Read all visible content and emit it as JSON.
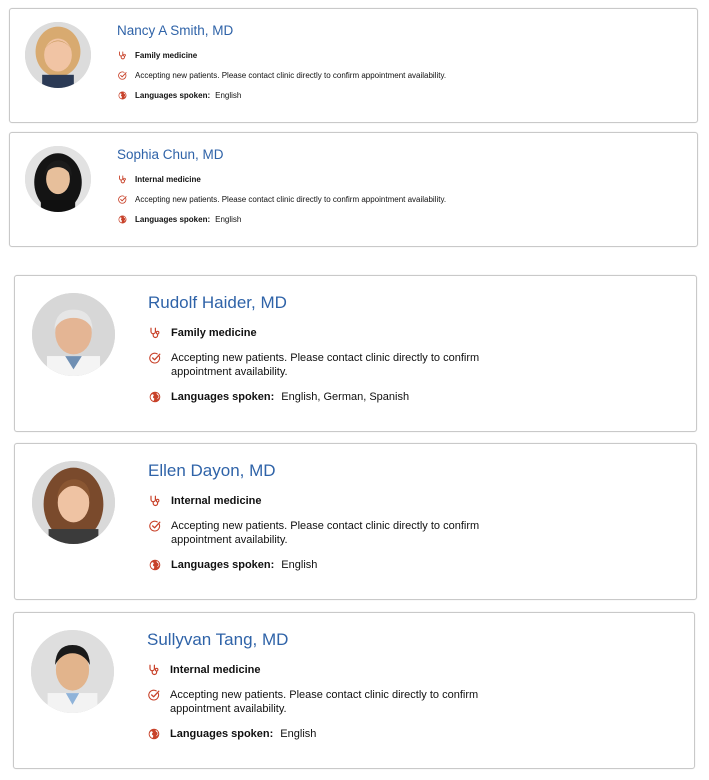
{
  "icons": {
    "specialty": "stethoscope-icon",
    "accepting": "check-circle-icon",
    "languages": "globe-icon"
  },
  "colors": {
    "name_link": "#2f63a8",
    "icon_accent": "#c8422a",
    "card_border": "#c9c9c9"
  },
  "doctors": [
    {
      "name": "Nancy A Smith, MD",
      "specialty": "Family medicine",
      "accepting": "Accepting new patients. Please contact clinic directly to confirm appointment availability.",
      "languages_label": "Languages spoken:",
      "languages": "English"
    },
    {
      "name": "Sophia Chun, MD",
      "specialty": "Internal medicine",
      "accepting": "Accepting new patients. Please contact clinic directly to confirm appointment availability.",
      "languages_label": "Languages spoken:",
      "languages": "English"
    },
    {
      "name": "Rudolf Haider, MD",
      "specialty": "Family medicine",
      "accepting": "Accepting new patients. Please contact clinic directly to confirm appointment availability.",
      "languages_label": "Languages spoken:",
      "languages": "English, German, Spanish"
    },
    {
      "name": "Ellen Dayon, MD",
      "specialty": "Internal medicine",
      "accepting": "Accepting new patients. Please contact clinic directly to confirm appointment availability.",
      "languages_label": "Languages spoken:",
      "languages": "English"
    },
    {
      "name": "Sullyvan Tang, MD",
      "specialty": "Internal medicine",
      "accepting": "Accepting new patients. Please contact clinic directly to confirm appointment availability.",
      "languages_label": "Languages spoken:",
      "languages": "English"
    }
  ]
}
